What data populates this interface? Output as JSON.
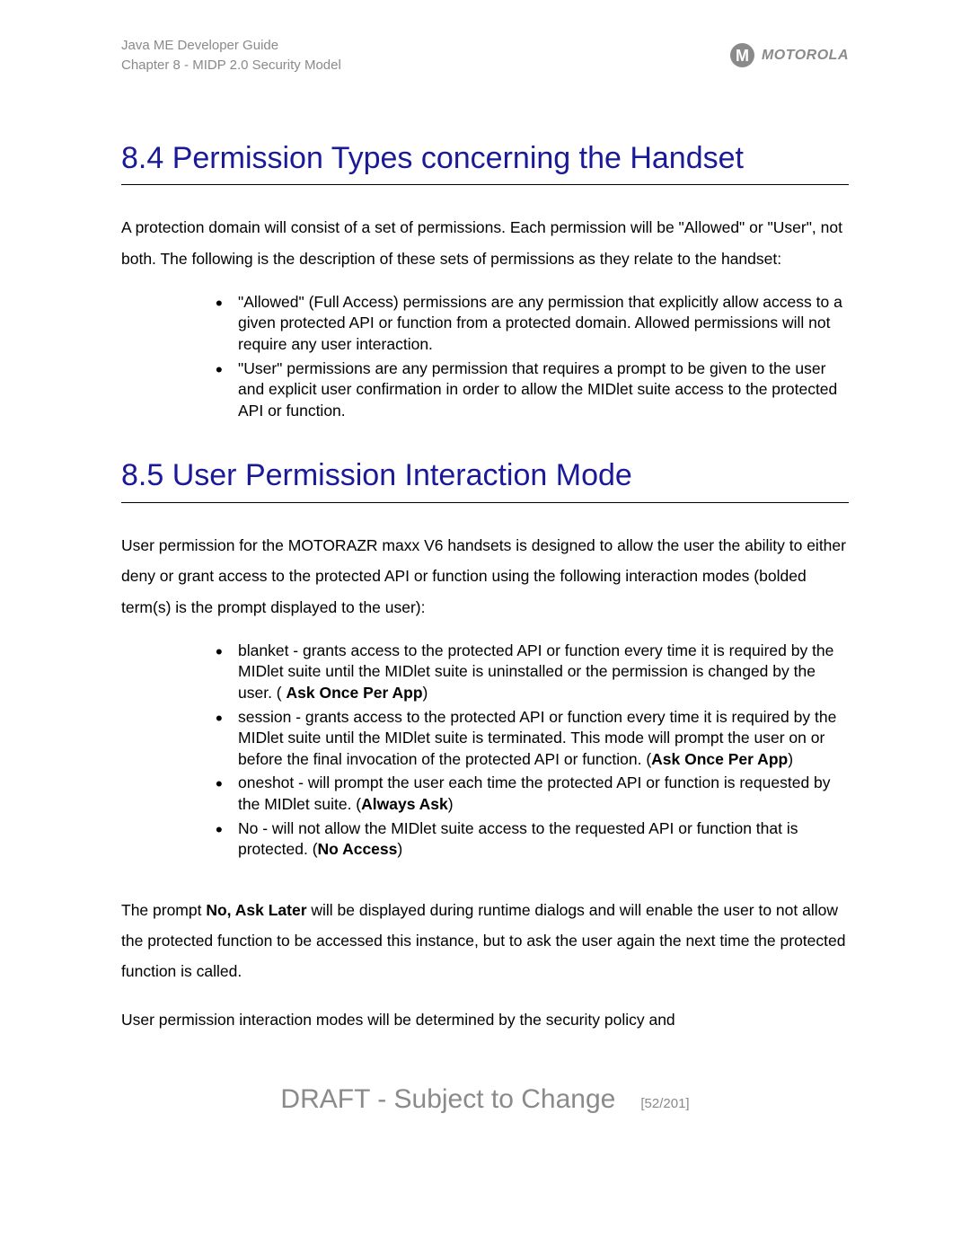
{
  "header": {
    "line1": "Java ME Developer Guide",
    "line2": "Chapter 8 - MIDP 2.0 Security Model",
    "brand": "MOTOROLA"
  },
  "sec84": {
    "title": "8.4 Permission Types concerning the Handset",
    "intro": "A protection domain will consist of a set of permissions. Each permission will be \"Allowed\" or \"User\", not both. The following is the description of these sets of permissions as they relate to the handset:",
    "bullets": [
      "\"Allowed\" (Full Access) permissions are any permission that explicitly allow access to a given protected API or function from a protected domain. Allowed permissions will not require any user interaction.",
      "\"User\" permissions are any permission that requires a prompt to be given to the user and explicit user confirmation in order to allow the MIDlet suite access to the protected API or function."
    ]
  },
  "sec85": {
    "title": "8.5 User Permission Interaction Mode",
    "intro": "User permission for the MOTORAZR maxx V6 handsets is designed to allow the user the ability to either deny or grant access to the protected API or function using the following interaction modes (bolded term(s) is the prompt displayed to the user):",
    "bullets": [
      {
        "pre": "blanket - grants access to the protected API or function every time it is required by the MIDlet suite until the MIDlet suite is uninstalled or the permission is changed by the user. ( ",
        "b": "Ask Once Per App",
        "post": ")"
      },
      {
        "pre": "session - grants access to the protected API or function every time it is required by the MIDlet suite until the MIDlet suite is terminated. This mode will prompt the user on or before the final invocation of the protected API or function. (",
        "b": "Ask Once Per App",
        "post": ")"
      },
      {
        "pre": "oneshot - will prompt the user each time the protected API or function is requested by the MIDlet suite. (",
        "b": "Always Ask",
        "post": ")"
      },
      {
        "pre": "No - will not allow the MIDlet suite access to the requested API or function that is protected. (",
        "b": "No Access",
        "post": ")"
      }
    ],
    "p2a": "The prompt ",
    "p2b": "No, Ask Later",
    "p2c": " will be displayed during runtime dialogs and will enable the user to not allow the protected function to be accessed this instance, but to ask the user again the next time the protected function is called.",
    "p3": "User permission interaction modes will be determined by the security policy and"
  },
  "footer": {
    "draft": "DRAFT - Subject to Change",
    "page": "[52/201]"
  }
}
